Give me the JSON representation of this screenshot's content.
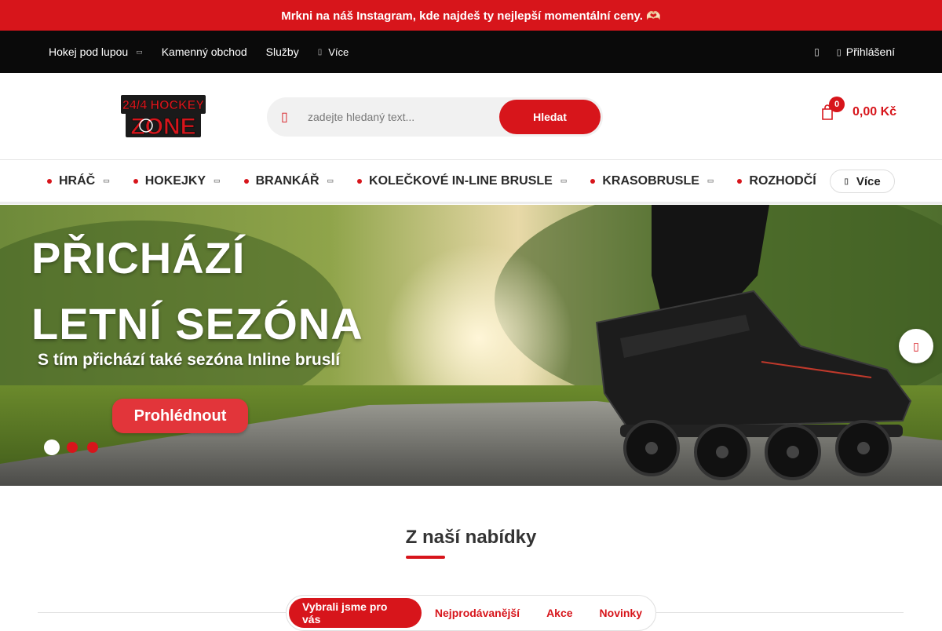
{
  "promo": {
    "text": "Mrkni na náš Instagram, kde najdeš ty nejlepší momentální ceny. 🫶🏻"
  },
  "topbar": {
    "items": [
      {
        "label": "Hokej pod lupou",
        "has_caret": true
      },
      {
        "label": "Kamenný obchod"
      },
      {
        "label": "Služby"
      }
    ],
    "more_label": "Více",
    "login_label": "Přihlášení"
  },
  "header": {
    "logo_alt": "24/7 HOCKEY ZONE",
    "logo_top": "24/4 HOCKEY",
    "logo_bottom": "ZONE",
    "search": {
      "placeholder": "zadejte hledaný text...",
      "button_label": "Hledat"
    },
    "cart": {
      "count": "0",
      "total": "0,00 Kč"
    }
  },
  "categories": {
    "items": [
      {
        "label": "HRÁČ",
        "has_caret": true
      },
      {
        "label": "HOKEJKY",
        "has_caret": true
      },
      {
        "label": "BRANKÁŘ",
        "has_caret": true
      },
      {
        "label": "KOLEČKOVÉ IN-LINE BRUSLE",
        "has_caret": true
      },
      {
        "label": "KRASOBRUSLE",
        "has_caret": true
      },
      {
        "label": "ROZHODČÍ",
        "has_caret": false
      }
    ],
    "more_label": "Více"
  },
  "banner": {
    "heading_line1": "PŘICHÁZÍ",
    "heading_line2": "LETNÍ SEZÓNA",
    "subheading": "S tím přichází také sezóna Inline bruslí",
    "cta_label": "Prohlédnout",
    "slides_total": 3,
    "active_slide": 1
  },
  "offer": {
    "title": "Z naší nabídky",
    "tabs": [
      {
        "label": "Vybrali jsme pro vás",
        "active": true
      },
      {
        "label": "Nejprodávanější",
        "active": false
      },
      {
        "label": "Akce",
        "active": false
      },
      {
        "label": "Novinky",
        "active": false
      }
    ]
  },
  "colors": {
    "brand_red": "#d7151b",
    "topbar_bg": "#0a0a0a",
    "text_dark": "#2a2a2a"
  }
}
